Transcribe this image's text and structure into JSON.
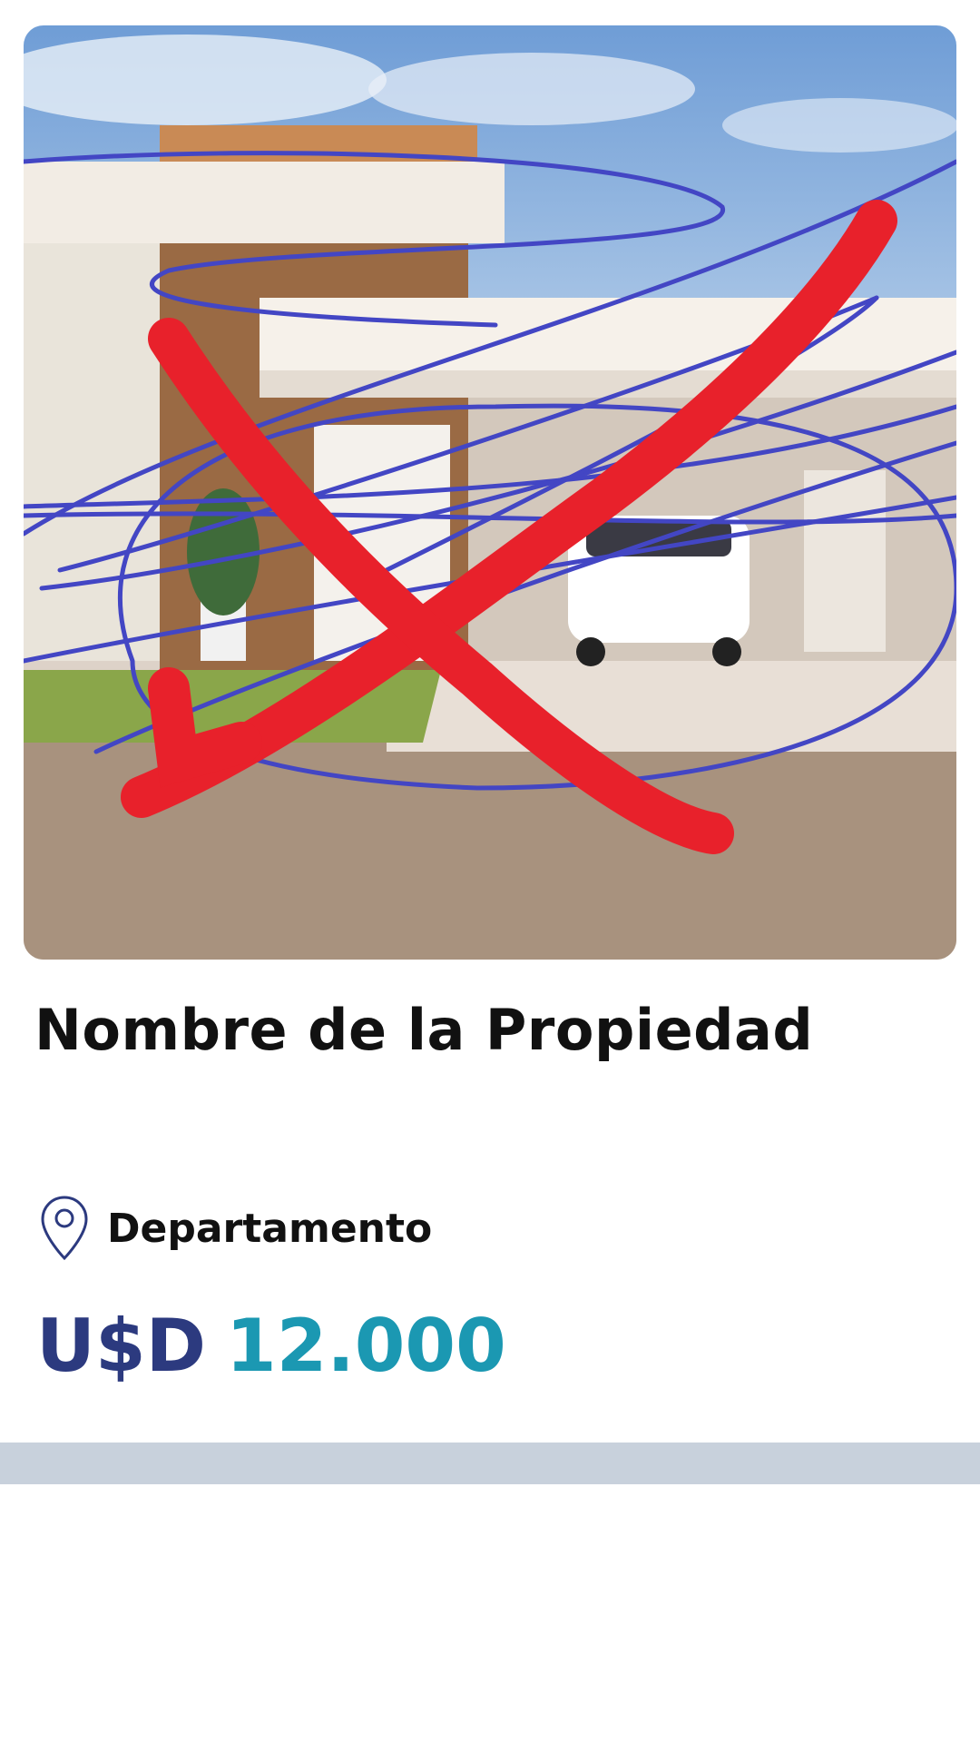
{
  "property": {
    "title": "Nombre de la Propiedad",
    "location": "Departamento",
    "price_currency": "U$D",
    "price_amount": "12.000"
  },
  "icons": {
    "location": "location-pin-icon"
  },
  "colors": {
    "currency": "#2c3a7f",
    "amount": "#1b98b2",
    "divider": "#c8d1dc",
    "cross_mark": "#e8212b",
    "scribble": "#4346c4"
  }
}
